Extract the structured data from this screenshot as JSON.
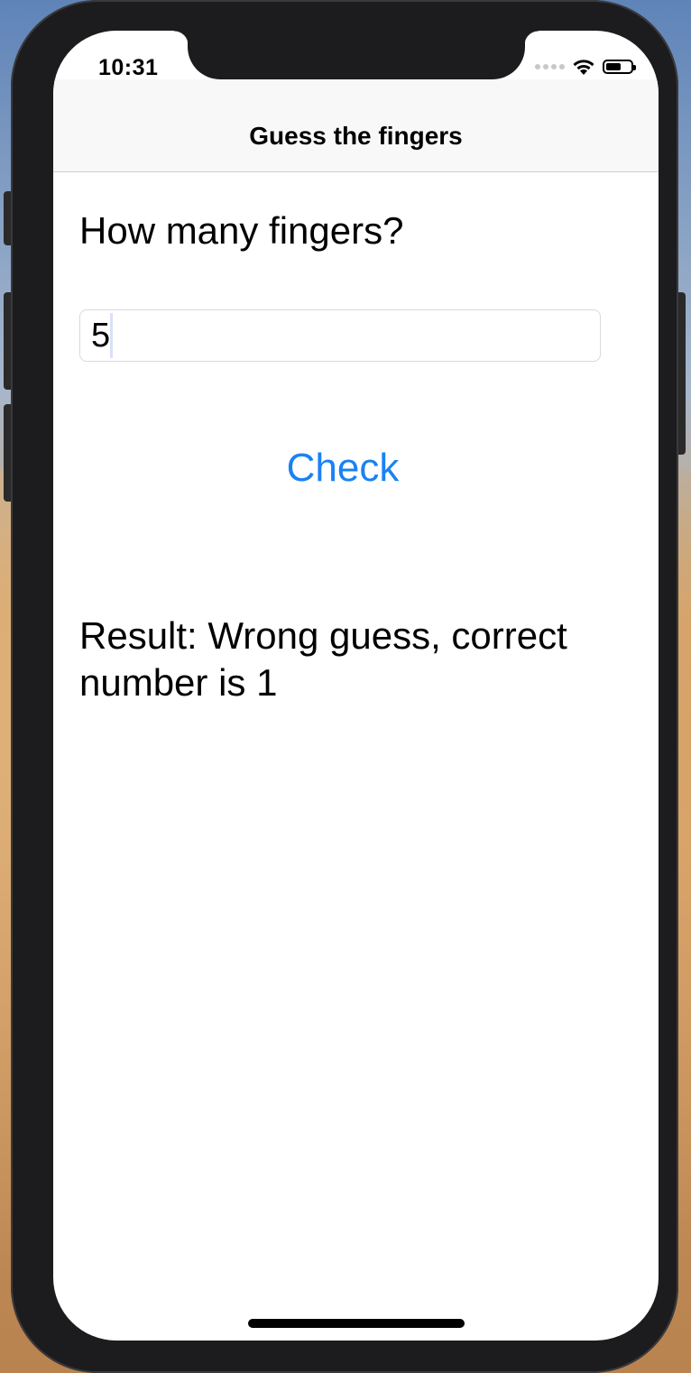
{
  "status_bar": {
    "time": "10:31"
  },
  "nav": {
    "title": "Guess the fingers"
  },
  "form": {
    "question": "How many fingers?",
    "input_value": "5",
    "check_label": "Check"
  },
  "result": {
    "text": "Result: Wrong guess, correct number is 1"
  },
  "colors": {
    "accent": "#1a82f3"
  },
  "icons": [
    "wifi-icon",
    "battery-icon",
    "signal-icon"
  ]
}
